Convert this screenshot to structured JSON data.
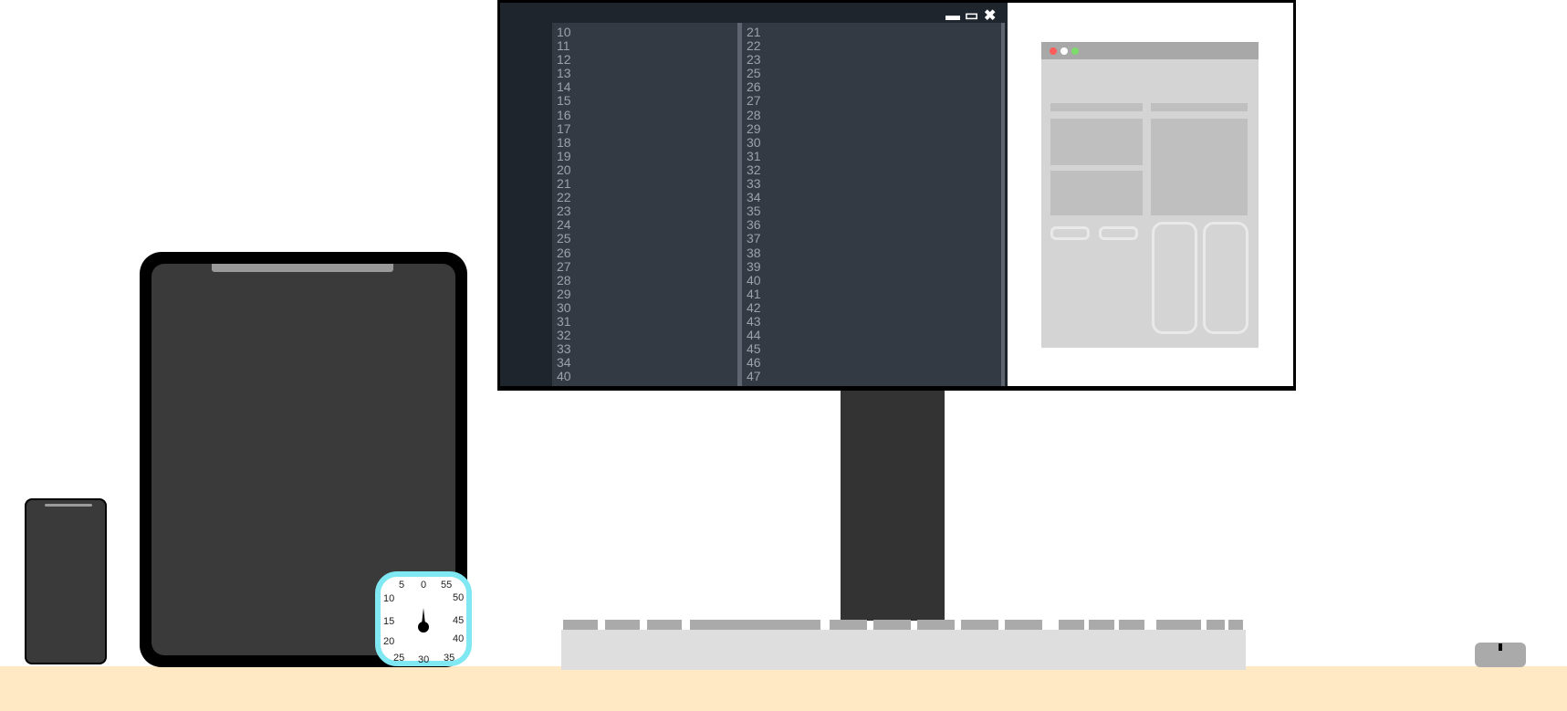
{
  "monitor": {
    "window_controls": {
      "minimize": "▬",
      "maximize": "▭",
      "close": "✖"
    },
    "left_column_lines": [
      "10",
      "11",
      "12",
      "13",
      "14",
      "15",
      "16",
      "17",
      "18",
      "19",
      "20",
      "21",
      "22",
      "23",
      "24",
      "25",
      "26",
      "27",
      "28",
      "29",
      "30",
      "31",
      "32",
      "33",
      "34",
      "40"
    ],
    "right_column_lines": [
      "21",
      "22",
      "23",
      "25",
      "26",
      "27",
      "28",
      "29",
      "30",
      "31",
      "32",
      "33",
      "34",
      "35",
      "36",
      "37",
      "38",
      "39",
      "40",
      "41",
      "42",
      "43",
      "44",
      "45",
      "46",
      "47"
    ],
    "preview_window_dots": [
      "#ff5b5b",
      "#ffffff",
      "#7ddb6b"
    ]
  },
  "timer": {
    "labels": {
      "t0": "0",
      "t5": "5",
      "t10": "10",
      "t15": "15",
      "t20": "20",
      "t25": "25",
      "t30": "30",
      "t35": "35",
      "t40": "40",
      "t45": "45",
      "t50": "50",
      "t55": "55"
    },
    "ring_color": "#7fe8f2"
  },
  "colors": {
    "desk": "#ffe9c4",
    "device_body": "#3a3a3a",
    "editor_bg": "#343a43"
  }
}
